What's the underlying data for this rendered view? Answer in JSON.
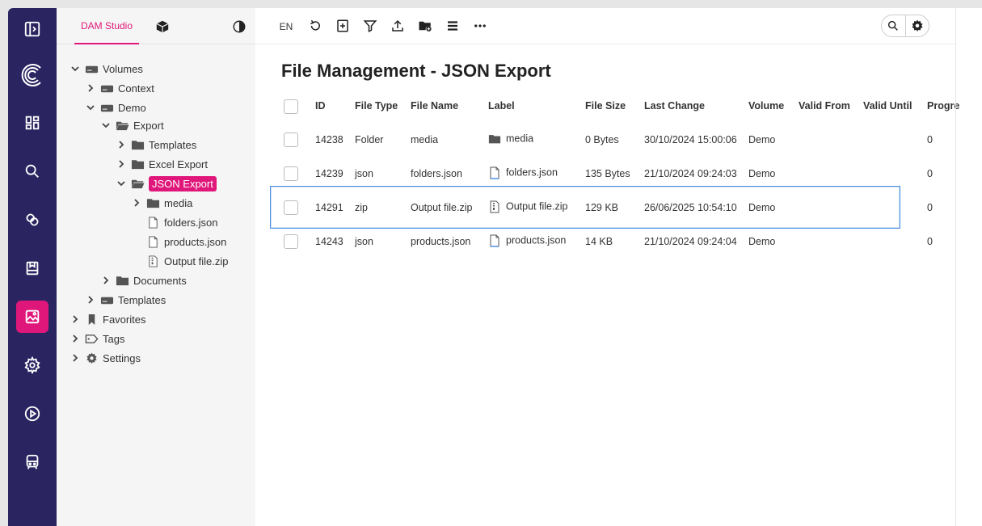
{
  "app": {
    "tab_label": "DAM Studio"
  },
  "toolbar": {
    "language": "EN"
  },
  "page": {
    "title": "File Management - JSON Export"
  },
  "tree": {
    "nodes": [
      {
        "label": "Volumes",
        "icon": "drive-icon"
      },
      {
        "label": "Context",
        "icon": "drive-icon"
      },
      {
        "label": "Demo",
        "icon": "drive-icon"
      },
      {
        "label": "Export",
        "icon": "folder-open-icon"
      },
      {
        "label": "Templates",
        "icon": "folder-icon"
      },
      {
        "label": "Excel Export",
        "icon": "folder-icon"
      },
      {
        "label": "JSON Export",
        "icon": "folder-open-icon",
        "selected": true
      },
      {
        "label": "media",
        "icon": "folder-icon"
      },
      {
        "label": "folders.json",
        "icon": "file-icon"
      },
      {
        "label": "products.json",
        "icon": "file-icon"
      },
      {
        "label": "Output file.zip",
        "icon": "zip-file-icon"
      },
      {
        "label": "Documents",
        "icon": "folder-icon"
      },
      {
        "label": "Templates",
        "icon": "drive-icon"
      },
      {
        "label": "Favorites",
        "icon": "bookmark-icon"
      },
      {
        "label": "Tags",
        "icon": "tag-icon"
      },
      {
        "label": "Settings",
        "icon": "gear-icon"
      }
    ]
  },
  "table": {
    "headers": [
      "ID",
      "File Type",
      "File Name",
      "Label",
      "File Size",
      "Last Change",
      "Volume",
      "Valid From",
      "Valid Until",
      "Progre"
    ],
    "rows": [
      {
        "id": "14238",
        "type": "Folder",
        "name": "media",
        "label": "media",
        "label_icon": "folder-icon",
        "size": "0 Bytes",
        "changed": "30/10/2024 15:00:06",
        "volume": "Demo",
        "progress": "0"
      },
      {
        "id": "14239",
        "type": "json",
        "name": "folders.json",
        "label": "folders.json",
        "label_icon": "file-icon",
        "size": "135 Bytes",
        "changed": "21/10/2024 09:24:03",
        "volume": "Demo",
        "progress": "0"
      },
      {
        "id": "14291",
        "type": "zip",
        "name": "Output file.zip",
        "label": "Output file.zip",
        "label_icon": "zip-file-icon",
        "size": "129 KB",
        "changed": "26/06/2025 10:54:10",
        "volume": "Demo",
        "progress": "0",
        "selected": true
      },
      {
        "id": "14243",
        "type": "json",
        "name": "products.json",
        "label": "products.json",
        "label_icon": "file-icon",
        "size": "14 KB",
        "changed": "21/10/2024 09:24:04",
        "volume": "Demo",
        "progress": "0"
      }
    ]
  },
  "colors": {
    "rail": "#2a2460",
    "accent": "#e0177a",
    "selection_border": "#4a8fe0"
  }
}
